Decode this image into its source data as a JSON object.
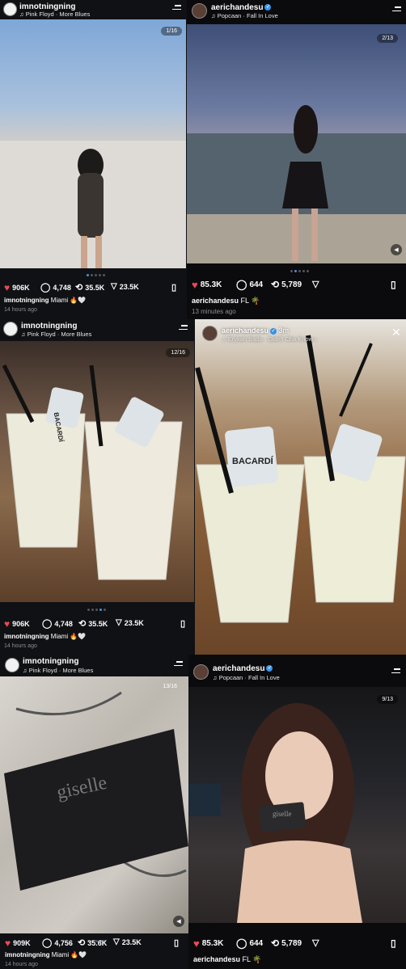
{
  "posts": [
    {
      "username": "imnotningning",
      "song": "Pink Floyd · More Blues",
      "counter": "1/16",
      "likes": "906K",
      "comments": "4,748",
      "reposts": "35.5K",
      "shares": "23.5K",
      "caption_user": "imnotningning",
      "caption_text": "Miami 🔥🤍",
      "time": "14 hours ago"
    },
    {
      "username": "aerichandesu",
      "song": "Popcaan · Fall In Love",
      "counter": "2/13",
      "likes": "85.3K",
      "comments": "644",
      "reposts": "5,789",
      "caption_user": "aerichandesu",
      "caption_text": "FL 🌴",
      "time": "13 minutes ago"
    },
    {
      "username": "imnotningning",
      "song": "Pink Floyd · More Blues",
      "counter": "12/16",
      "likes": "906K",
      "comments": "4,748",
      "reposts": "35.5K",
      "shares": "23.5K",
      "caption_user": "imnotningning",
      "caption_text": "Miami 🔥🤍",
      "time": "14 hours ago"
    },
    {
      "story_user": "aerichandesu",
      "story_time": "3m",
      "story_song": "Erykah Badu · Didn't Cha Know ›"
    },
    {
      "username": "imnotningning",
      "song": "Pink Floyd · More Blues",
      "counter": "13/16",
      "likes": "909K",
      "comments": "4,756",
      "reposts": "35.6K",
      "shares": "23.5K",
      "caption_user": "imnotningning",
      "caption_text": "Miami 🔥🤍",
      "time": "14 hours ago"
    },
    {
      "username": "aerichandesu",
      "song": "Popcaan · Fall In Love",
      "counter": "9/13",
      "likes": "85.3K",
      "comments": "644",
      "reposts": "5,789",
      "caption_user": "aerichandesu",
      "caption_text": "FL 🌴"
    }
  ],
  "photo_text": {
    "bottle_label": "BACARDÍ",
    "card_text": "giselle"
  },
  "colors": {
    "like_red": "#ed4956",
    "verified_blue": "#3897f0",
    "dot_active": "#4a90e2"
  },
  "icons": [
    "heart-icon",
    "comment-icon",
    "repost-icon",
    "share-icon",
    "bookmark-icon",
    "menu-icon",
    "music-icon",
    "sound-icon",
    "close-icon",
    "verified-icon"
  ]
}
